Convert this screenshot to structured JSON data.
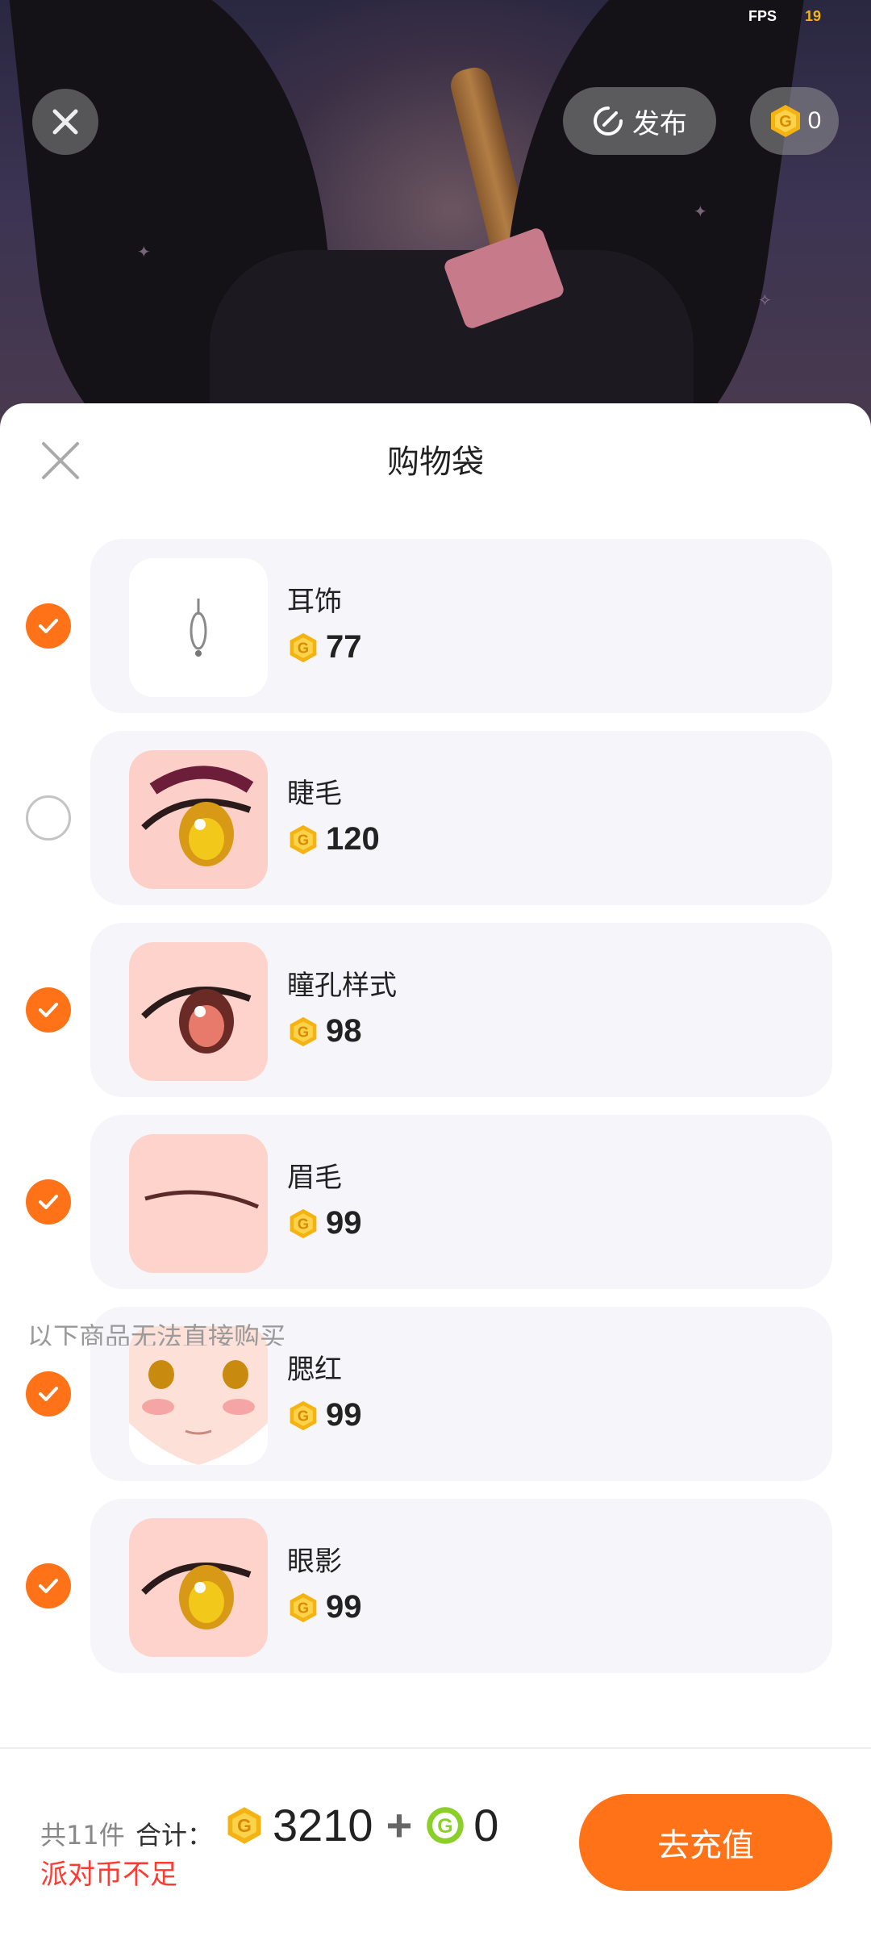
{
  "hud": {
    "fps_label": "FPS",
    "fps_value": "19"
  },
  "topbar": {
    "publish_label": "发布",
    "coin_balance": "0"
  },
  "sheet": {
    "title": "购物袋",
    "items": [
      {
        "name": "耳饰",
        "price": "77",
        "checked": true,
        "thumb": "earring"
      },
      {
        "name": "睫毛",
        "price": "120",
        "checked": false,
        "thumb": "eyelash"
      },
      {
        "name": "瞳孔样式",
        "price": "98",
        "checked": true,
        "thumb": "pupil"
      },
      {
        "name": "眉毛",
        "price": "99",
        "checked": true,
        "thumb": "eyebrow"
      },
      {
        "name": "腮红",
        "price": "99",
        "checked": true,
        "thumb": "blush"
      },
      {
        "name": "眼影",
        "price": "99",
        "checked": true,
        "thumb": "eyeshadow"
      }
    ],
    "notice": "以下商品无法直接购买"
  },
  "footer": {
    "count_text": "共11件",
    "total_label": "合计：",
    "gold_total": "3210",
    "plus": "+",
    "green_total": "0",
    "warning": "派对币不足",
    "recharge_label": "去充值"
  },
  "colors": {
    "accent": "#ff7217",
    "warning": "#ff3b30",
    "coin_gold": "#f5b312",
    "coin_green": "#8bcf2a"
  }
}
